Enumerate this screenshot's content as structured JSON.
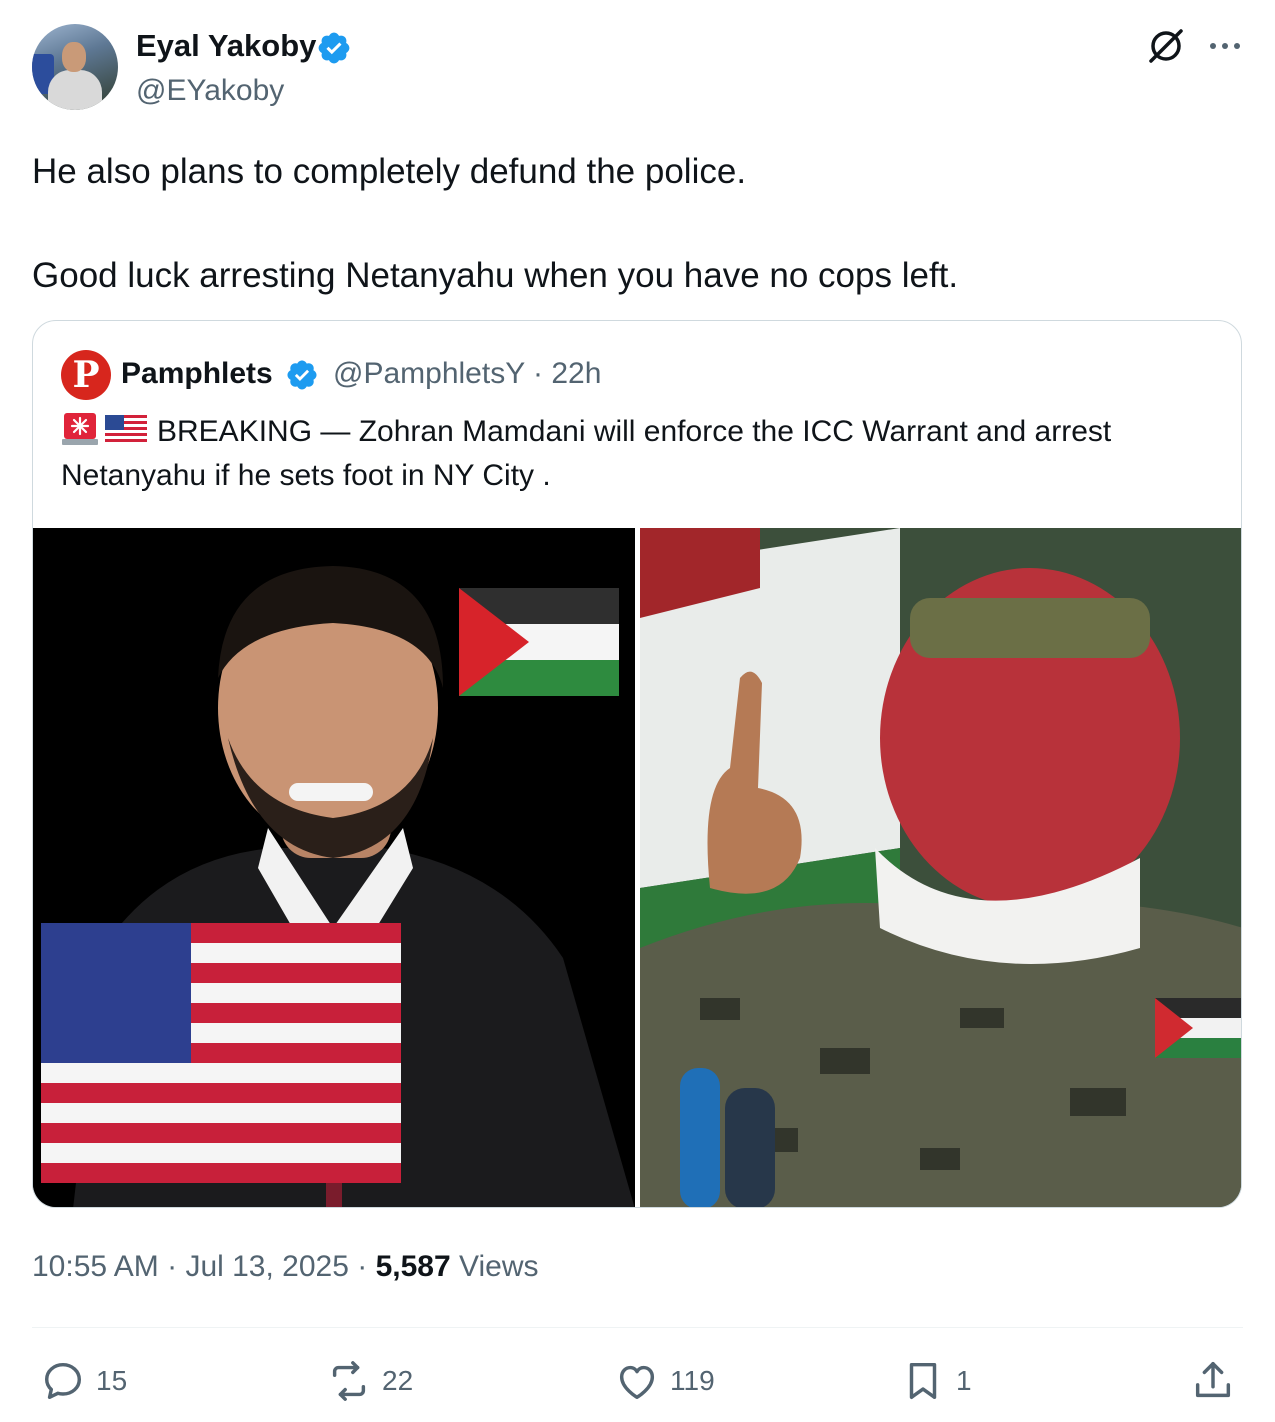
{
  "author": {
    "name": "Eyal Yakoby",
    "handle": "@EYakoby",
    "verified": true
  },
  "tweet": {
    "paragraphs": [
      "He also plans to completely defund the police.",
      "Good luck arresting Netanyahu when you have no cops left."
    ]
  },
  "quoted": {
    "name": "Pamphlets",
    "handle": "@PamphletsY",
    "time": "22h",
    "logo_letter": "P",
    "text": "BREAKING — Zohran Mamdani will enforce the ICC Warrant and arrest Netanyahu if he sets foot in NY City ."
  },
  "meta": {
    "time": "10:55 AM",
    "date": "Jul 13, 2025",
    "views_count": "5,587",
    "views_label": "Views"
  },
  "actions": {
    "replies": "15",
    "reposts": "22",
    "likes": "119",
    "bookmarks": "1"
  },
  "colors": {
    "accent": "#1d9bf0",
    "text": "#0f1419",
    "secondary": "#536471",
    "border": "#cfd9de"
  },
  "icons": [
    "verified-badge-icon",
    "grok-icon",
    "more-icon",
    "reply-icon",
    "repost-icon",
    "like-icon",
    "bookmark-icon",
    "share-icon"
  ]
}
